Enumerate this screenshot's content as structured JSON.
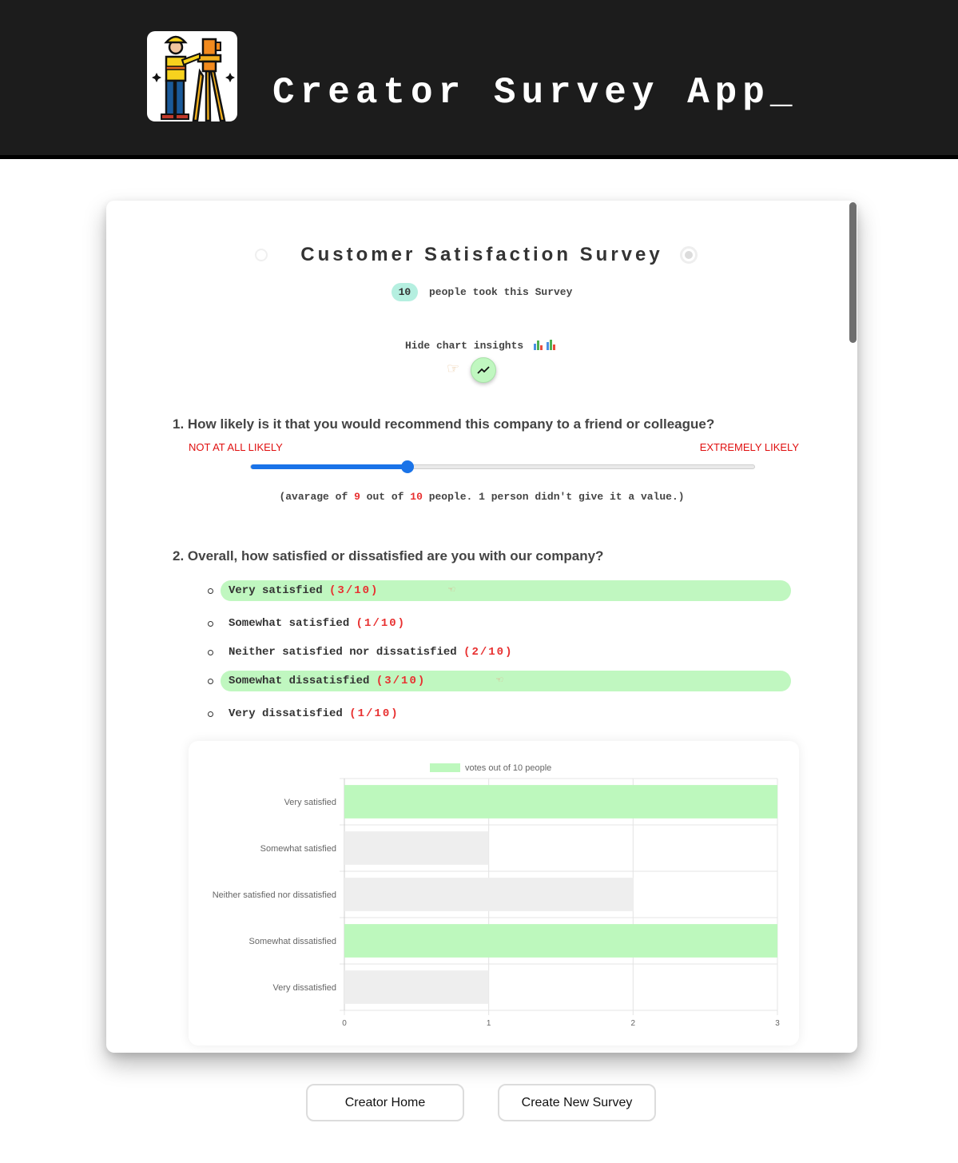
{
  "header": {
    "app_title": "Creator Survey App_",
    "logo_icon": "surveyor-icon"
  },
  "survey": {
    "title": "Customer Satisfaction Survey",
    "respondents": "10",
    "respondents_text": "people took this Survey",
    "insights_toggle_label": "Hide chart insights",
    "insights_icon": "bar-chart-icon"
  },
  "questions": [
    {
      "title": "1. How likely is it that you would recommend this company to a friend or colleague?",
      "scale_min_label": "NOT AT ALL LIKELY",
      "scale_max_label": "EXTREMELY LIKELY",
      "slider_value": 0.31,
      "avg_prefix": "(avarage of ",
      "avg_count": "9",
      "avg_mid": " out of ",
      "avg_total": "10",
      "avg_suffix": " people. 1 person didn't give it a value.)"
    },
    {
      "title": "2. Overall, how satisfied or dissatisfied are you with our company?",
      "options": [
        {
          "label": "Very satisfied",
          "count": "(3/10)",
          "highlight": true
        },
        {
          "label": "Somewhat satisfied",
          "count": "(1/10)",
          "highlight": false
        },
        {
          "label": "Neither satisfied nor dissatisfied",
          "count": "(2/10)",
          "highlight": false
        },
        {
          "label": "Somewhat dissatisfied",
          "count": "(3/10)",
          "highlight": true
        },
        {
          "label": "Very dissatisfied",
          "count": "(1/10)",
          "highlight": false
        }
      ]
    }
  ],
  "chart_data": {
    "type": "bar",
    "orientation": "horizontal",
    "categories": [
      "Very satisfied",
      "Somewhat satisfied",
      "Neither satisfied nor dissatisfied",
      "Somewhat dissatisfied",
      "Very dissatisfied"
    ],
    "series": [
      {
        "name": "votes out of 10 people",
        "values": [
          3,
          1,
          2,
          3,
          1
        ]
      }
    ],
    "xlim": [
      0,
      3
    ],
    "xticks": [
      "0",
      "1",
      "2",
      "3"
    ],
    "legend": "top",
    "grid": true,
    "colors": {
      "top": "#bdf8bd",
      "other": "#eeeeee"
    }
  },
  "footer": {
    "home_label": "Creator Home",
    "new_label": "Create New Survey"
  },
  "colors": {
    "header_bg": "#1c1c1c",
    "highlight": "#c0f7c0",
    "accent_red": "#e83030",
    "slider_blue": "#1a73e8"
  }
}
